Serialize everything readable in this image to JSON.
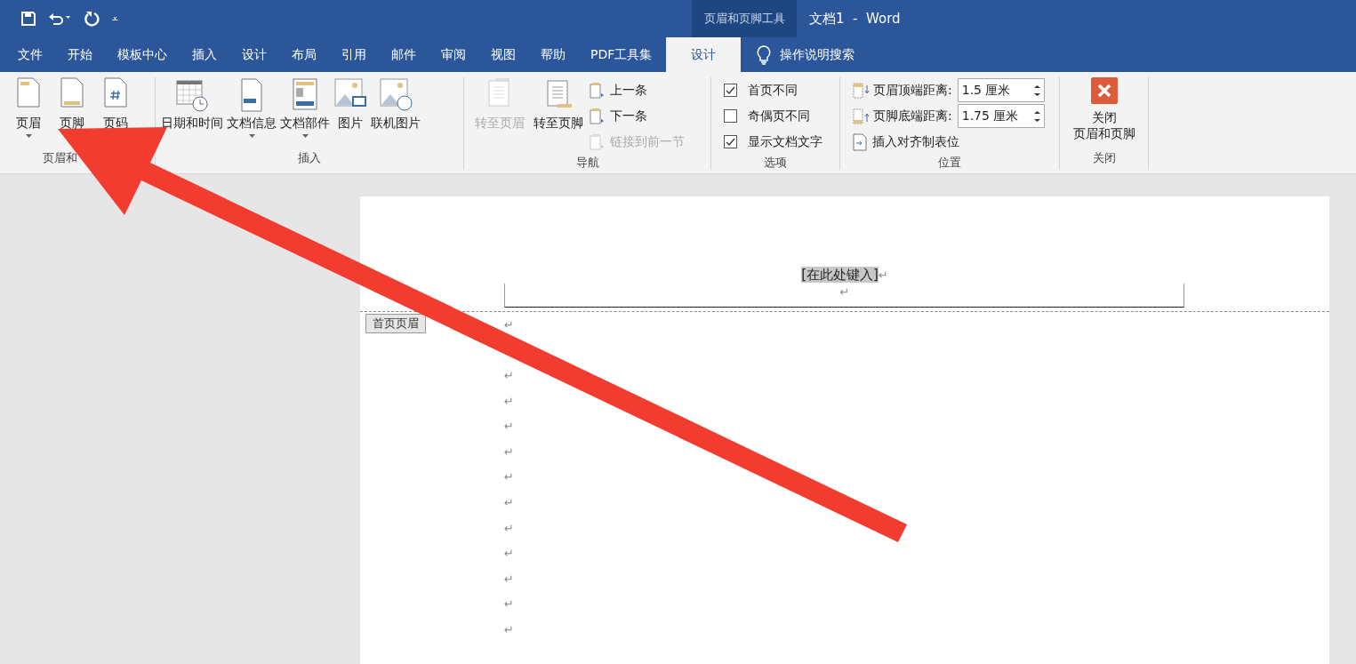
{
  "quick_access": {
    "customize": "⩡"
  },
  "title_bar": {
    "context_label": "页眉和页脚工具",
    "title": "文档1  -  Word"
  },
  "tabs": [
    {
      "label": "文件",
      "selected": false
    },
    {
      "label": "开始",
      "selected": false
    },
    {
      "label": "模板中心",
      "selected": false
    },
    {
      "label": "插入",
      "selected": false
    },
    {
      "label": "设计",
      "selected": false
    },
    {
      "label": "布局",
      "selected": false
    },
    {
      "label": "引用",
      "selected": false
    },
    {
      "label": "邮件",
      "selected": false
    },
    {
      "label": "审阅",
      "selected": false
    },
    {
      "label": "视图",
      "selected": false
    },
    {
      "label": "帮助",
      "selected": false
    },
    {
      "label": "PDF工具集",
      "selected": false
    },
    {
      "label": "设计",
      "selected": true
    }
  ],
  "search": {
    "placeholder": "操作说明搜索"
  },
  "ribbon": {
    "header_footer": {
      "label": "页眉和",
      "buttons": [
        {
          "label": "页眉",
          "dropdown": true
        },
        {
          "label": "页脚",
          "dropdown": false
        },
        {
          "label": "页码",
          "dropdown": false
        }
      ]
    },
    "insert": {
      "label": "插入",
      "buttons": [
        {
          "label": "日期和时间",
          "dropdown": false
        },
        {
          "label": "文档信息",
          "dropdown": true
        },
        {
          "label": "文档部件",
          "dropdown": true
        },
        {
          "label": "图片",
          "dropdown": false
        },
        {
          "label": "联机图片",
          "dropdown": false
        }
      ]
    },
    "navigation": {
      "label": "导航",
      "buttons": [
        {
          "label": "转至页眉",
          "disabled": true
        },
        {
          "label": "转至页脚",
          "disabled": false
        }
      ],
      "small_buttons": [
        {
          "label": "上一条",
          "disabled": false
        },
        {
          "label": "下一条",
          "disabled": false
        },
        {
          "label": "链接到前一节",
          "disabled": true
        }
      ]
    },
    "options": {
      "label": "选项",
      "checkboxes": [
        {
          "label": "首页不同",
          "checked": true
        },
        {
          "label": "奇偶页不同",
          "checked": false
        },
        {
          "label": "显示文档文字",
          "checked": true
        }
      ]
    },
    "position": {
      "label": "位置",
      "fields": [
        {
          "label": "页眉顶端距离:",
          "value": "1.5 厘米"
        },
        {
          "label": "页脚底端距离:",
          "value": "1.75 厘米"
        }
      ],
      "insert_tab": "插入对齐制表位"
    },
    "close": {
      "label": "关闭",
      "button_lines": [
        "关闭",
        "页眉和页脚"
      ]
    }
  },
  "document": {
    "header_text": "[在此处键入]",
    "header_mark": "↵",
    "header_line_mark": "↵",
    "header_tag": "首页页眉",
    "body_marks": [
      "↵",
      "↵",
      "↵",
      "↵",
      "↵",
      "↵",
      "↵",
      "↵",
      "↵",
      "↵",
      "↵",
      "↵"
    ]
  }
}
